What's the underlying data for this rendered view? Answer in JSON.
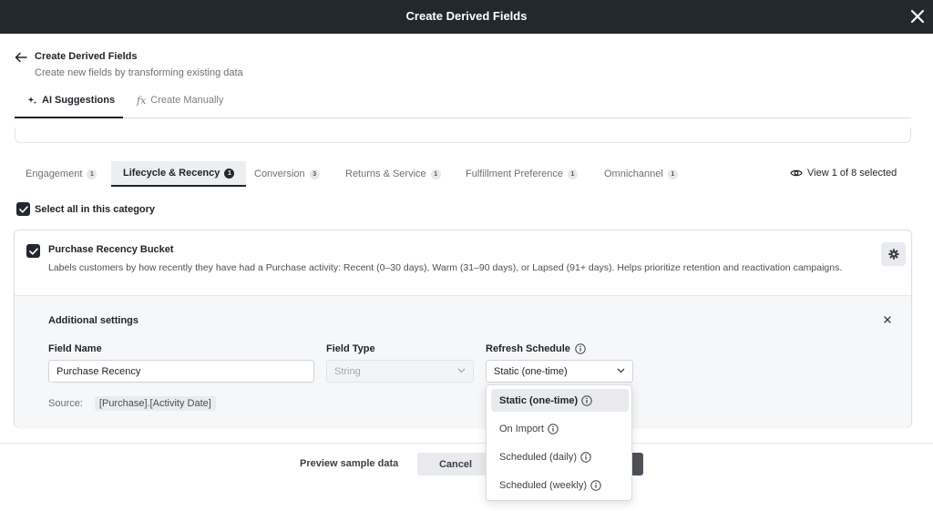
{
  "window": {
    "title": "Create Derived Fields"
  },
  "header": {
    "title": "Create Derived Fields",
    "subtitle": "Create new fields by transforming existing data"
  },
  "mode_tabs": [
    {
      "label": "AI Suggestions",
      "active": true
    },
    {
      "label": "Create Manually",
      "active": false
    }
  ],
  "category_tabs": [
    {
      "label": "Engagement",
      "count": "1",
      "active": false
    },
    {
      "label": "Lifecycle & Recency",
      "count": "1",
      "active": true
    },
    {
      "label": "Conversion",
      "count": "3",
      "active": false
    },
    {
      "label": "Returns & Service",
      "count": "1",
      "active": false
    },
    {
      "label": "Fulfillment Preference",
      "count": "1",
      "active": false
    },
    {
      "label": "Omnichannel",
      "count": "1",
      "active": false
    }
  ],
  "view_selected": "View 1 of 8 selected",
  "select_all_label": "Select all in this category",
  "field": {
    "title": "Purchase Recency Bucket",
    "description": "Labels customers by how recently they have had a Purchase activity: Recent (0–30 days), Warm (31–90 days), or Lapsed (91+ days). Helps prioritize retention and reactivation campaigns.",
    "settings": {
      "title": "Additional settings",
      "field_name_label": "Field Name",
      "field_name_value": "Purchase Recency",
      "field_type_label": "Field Type",
      "field_type_value": "String",
      "refresh_label": "Refresh Schedule",
      "refresh_value": "Static (one-time)",
      "source_label": "Source:",
      "source_value": "[Purchase].[Activity Date]"
    }
  },
  "refresh_options": [
    {
      "label": "Static (one-time)",
      "selected": true
    },
    {
      "label": "On Import",
      "selected": false
    },
    {
      "label": "Scheduled (daily)",
      "selected": false
    },
    {
      "label": "Scheduled (weekly)",
      "selected": false
    }
  ],
  "footer": {
    "preview_label": "Preview sample data",
    "cancel_label": "Cancel"
  },
  "colors": {
    "topbar": "#23272e",
    "accent": "#23272e",
    "primary_button": "#4e5258"
  }
}
